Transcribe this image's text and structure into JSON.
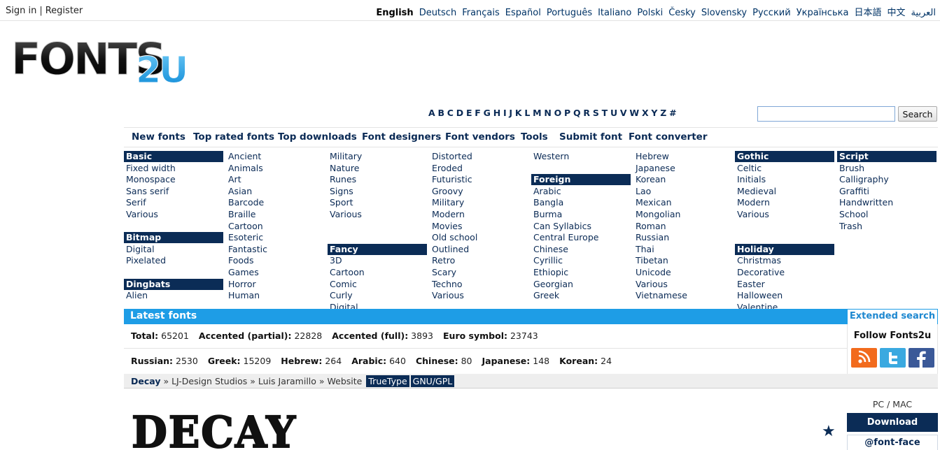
{
  "auth": {
    "sign_in": "Sign in",
    "separator": "|",
    "register": "Register"
  },
  "languages": [
    "English",
    "Deutsch",
    "Français",
    "Español",
    "Português",
    "Italiano",
    "Polski",
    "Česky",
    "Slovensky",
    "Русский",
    "Українська",
    "日本語",
    "中文",
    "العربية"
  ],
  "active_language": "English",
  "logo": {
    "main": "FONTS",
    "accent": "2U"
  },
  "alphabet": [
    "A",
    "B",
    "C",
    "D",
    "E",
    "F",
    "G",
    "H",
    "I",
    "J",
    "K",
    "L",
    "M",
    "N",
    "O",
    "P",
    "Q",
    "R",
    "S",
    "T",
    "U",
    "V",
    "W",
    "X",
    "Y",
    "Z",
    "#"
  ],
  "search": {
    "button": "Search",
    "value": ""
  },
  "nav": [
    "New fonts",
    "Top rated fonts",
    "Top downloads",
    "Font designers",
    "Font vendors",
    "Tools",
    "Submit font",
    "Font converter"
  ],
  "categories": [
    [
      {
        "h": "Basic"
      },
      "Fixed width",
      "Monospace",
      "Sans serif",
      "Serif",
      "Various",
      "",
      {
        "h": "Bitmap"
      },
      "Digital",
      "Pixelated",
      "",
      {
        "h": "Dingbats"
      },
      "Alien"
    ],
    [
      "Ancient",
      "Animals",
      "Art",
      "Asian",
      "Barcode",
      "Braille",
      "Cartoon",
      "Esoteric",
      "Fantastic",
      "Foods",
      "Games",
      "Horror",
      "Human"
    ],
    [
      "Military",
      "Nature",
      "Runes",
      "Signs",
      "Sport",
      "Various",
      "",
      "",
      {
        "h": "Fancy"
      },
      "3D",
      "Cartoon",
      "Comic",
      "Curly",
      "Digital"
    ],
    [
      "Distorted",
      "Eroded",
      "Futuristic",
      "Groovy",
      "Military",
      "Modern",
      "Movies",
      "Old school",
      "Outlined",
      "Retro",
      "Scary",
      "Techno",
      "Various"
    ],
    [
      "Western",
      "",
      {
        "h": "Foreign"
      },
      "Arabic",
      "Bangla",
      "Burma",
      "Can Syllabics",
      "Central Europe",
      "Chinese",
      "Cyrillic",
      "Ethiopic",
      "Georgian",
      "Greek"
    ],
    [
      "Hebrew",
      "Japanese",
      "Korean",
      "Lao",
      "Mexican",
      "Mongolian",
      "Roman",
      "Russian",
      "Thai",
      "Tibetan",
      "Unicode",
      "Various",
      "Vietnamese"
    ],
    [
      {
        "h": "Gothic"
      },
      "Celtic",
      "Initials",
      "Medieval",
      "Modern",
      "Various",
      "",
      "",
      {
        "h": "Holiday"
      },
      "Christmas",
      "Decorative",
      "Easter",
      "Halloween",
      "Valentine"
    ],
    [
      {
        "h": "Script"
      },
      "Brush",
      "Calligraphy",
      "Graffiti",
      "Handwritten",
      "School",
      "Trash"
    ]
  ],
  "latest": {
    "title": "Latest fonts",
    "extended_search": "Extended search",
    "row1": [
      {
        "k": "Total:",
        "v": "65201"
      },
      {
        "k": "Accented (partial):",
        "v": "22828"
      },
      {
        "k": "Accented (full):",
        "v": "3893"
      },
      {
        "k": "Euro symbol:",
        "v": "23743"
      }
    ],
    "row2": [
      {
        "k": "Russian:",
        "v": "2530"
      },
      {
        "k": "Greek:",
        "v": "15209"
      },
      {
        "k": "Hebrew:",
        "v": "264"
      },
      {
        "k": "Arabic:",
        "v": "640"
      },
      {
        "k": "Chinese:",
        "v": "80"
      },
      {
        "k": "Japanese:",
        "v": "148"
      },
      {
        "k": "Korean:",
        "v": "24"
      }
    ]
  },
  "follow": {
    "title": "Follow Fonts2u",
    "icons": [
      "rss-icon",
      "twitter-icon",
      "facebook-icon"
    ]
  },
  "breadcrumb": {
    "font": "Decay",
    "sep": "»",
    "designer": "LJ-Design Studios",
    "author": "Luis Jaramillo",
    "website": "Website",
    "tags": [
      "TrueType",
      "GNU/GPL"
    ]
  },
  "preview": {
    "text": "DECAY",
    "platform": "PC / MAC",
    "download": "Download",
    "fontface": "@font-face"
  },
  "colors": {
    "navy": "#0b2c56",
    "blue": "#1e9de6",
    "orange": "#f26b1d"
  }
}
